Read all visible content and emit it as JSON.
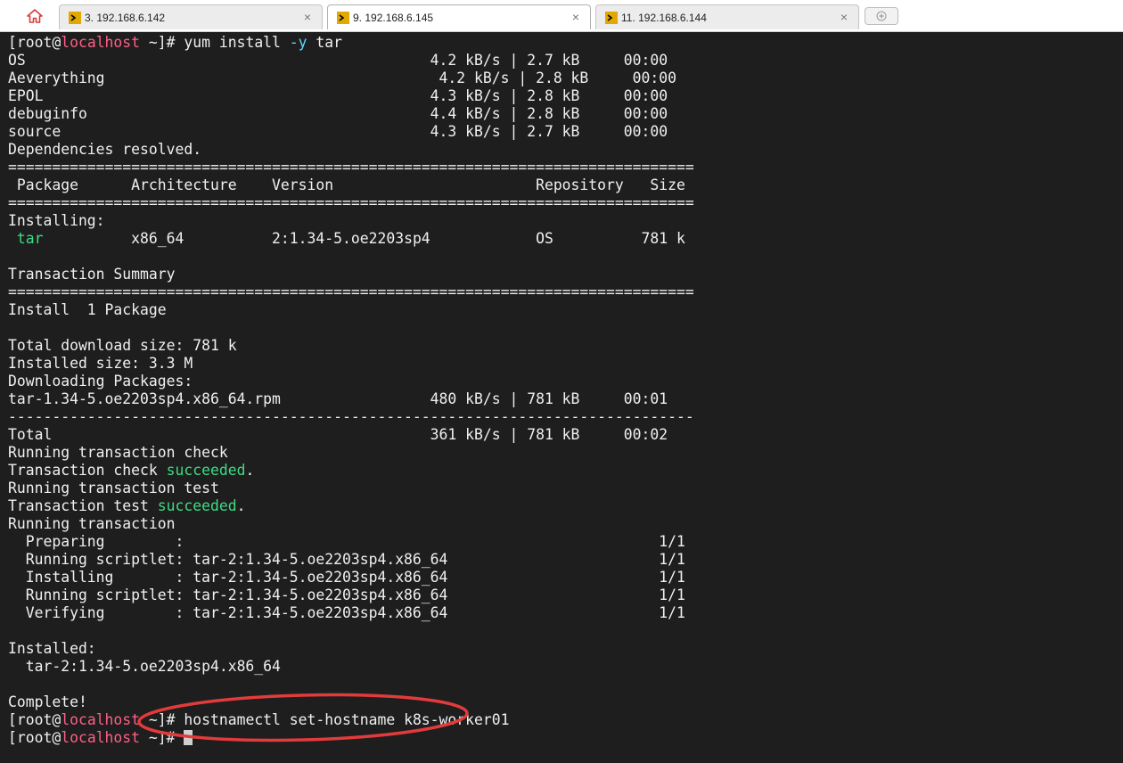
{
  "tabs": [
    {
      "label": "3. 192.168.6.142",
      "close": "×",
      "active": false
    },
    {
      "label": "9. 192.168.6.145",
      "close": "×",
      "active": true
    },
    {
      "label": "11. 192.168.6.144",
      "close": "×",
      "active": false
    }
  ],
  "colors": {
    "terminal_bg": "#1e1e1e",
    "text": "#f0f0f0",
    "hostname": "#ff5f87",
    "option": "#5fd7ff",
    "success": "#3ddc84",
    "annotation": "#e23b3b"
  },
  "terminal": {
    "lines": [
      [
        {
          "t": "[root@"
        },
        {
          "t": "localhost",
          "c": "host"
        },
        {
          "t": " ~]# yum install "
        },
        {
          "t": "-y",
          "c": "opt"
        },
        {
          "t": " tar"
        }
      ],
      [
        {
          "t": "OS                                              4.2 kB/s | 2.7 kB     00:00"
        }
      ],
      [
        {
          "t": "Aeverything                                      4.2 kB/s | 2.8 kB     00:00"
        }
      ],
      [
        {
          "t": "EPOL                                            4.3 kB/s | 2.8 kB     00:00"
        }
      ],
      [
        {
          "t": "debuginfo                                       4.4 kB/s | 2.8 kB     00:00"
        }
      ],
      [
        {
          "t": "source                                          4.3 kB/s | 2.7 kB     00:00"
        }
      ],
      [
        {
          "t": "Dependencies resolved."
        }
      ],
      [
        {
          "t": "=============================================================================="
        }
      ],
      [
        {
          "t": " Package      Architecture    Version                       Repository   Size"
        }
      ],
      [
        {
          "t": "=============================================================================="
        }
      ],
      [
        {
          "t": "Installing:"
        }
      ],
      [
        {
          "t": " "
        },
        {
          "t": "tar",
          "c": "pkg"
        },
        {
          "t": "          x86_64          2:1.34-5.oe2203sp4            OS          781 k"
        }
      ],
      [
        {
          "t": ""
        }
      ],
      [
        {
          "t": "Transaction Summary"
        }
      ],
      [
        {
          "t": "=============================================================================="
        }
      ],
      [
        {
          "t": "Install  1 Package"
        }
      ],
      [
        {
          "t": ""
        }
      ],
      [
        {
          "t": "Total download size: 781 k"
        }
      ],
      [
        {
          "t": "Installed size: 3.3 M"
        }
      ],
      [
        {
          "t": "Downloading Packages:"
        }
      ],
      [
        {
          "t": "tar-1.34-5.oe2203sp4.x86_64.rpm                 480 kB/s | 781 kB     00:01"
        }
      ],
      [
        {
          "t": "------------------------------------------------------------------------------"
        }
      ],
      [
        {
          "t": "Total                                           361 kB/s | 781 kB     00:02"
        }
      ],
      [
        {
          "t": "Running transaction check"
        }
      ],
      [
        {
          "t": "Transaction check "
        },
        {
          "t": "succeeded",
          "c": "ok"
        },
        {
          "t": "."
        }
      ],
      [
        {
          "t": "Running transaction test"
        }
      ],
      [
        {
          "t": "Transaction test "
        },
        {
          "t": "succeeded",
          "c": "ok"
        },
        {
          "t": "."
        }
      ],
      [
        {
          "t": "Running transaction"
        }
      ],
      [
        {
          "t": "  Preparing        :                                                      1/1"
        }
      ],
      [
        {
          "t": "  Running scriptlet: tar-2:1.34-5.oe2203sp4.x86_64                        1/1"
        }
      ],
      [
        {
          "t": "  Installing       : tar-2:1.34-5.oe2203sp4.x86_64                        1/1"
        }
      ],
      [
        {
          "t": "  Running scriptlet: tar-2:1.34-5.oe2203sp4.x86_64                        1/1"
        }
      ],
      [
        {
          "t": "  Verifying        : tar-2:1.34-5.oe2203sp4.x86_64                        1/1"
        }
      ],
      [
        {
          "t": ""
        }
      ],
      [
        {
          "t": "Installed:"
        }
      ],
      [
        {
          "t": "  tar-2:1.34-5.oe2203sp4.x86_64"
        }
      ],
      [
        {
          "t": ""
        }
      ],
      [
        {
          "t": "Complete!"
        }
      ],
      [
        {
          "t": "[root@"
        },
        {
          "t": "localhost",
          "c": "host"
        },
        {
          "t": " ~]# hostnamectl set-hostname k8s-worker01"
        }
      ],
      [
        {
          "t": "[root@"
        },
        {
          "t": "localhost",
          "c": "host"
        },
        {
          "t": " ~]# "
        }
      ]
    ]
  }
}
